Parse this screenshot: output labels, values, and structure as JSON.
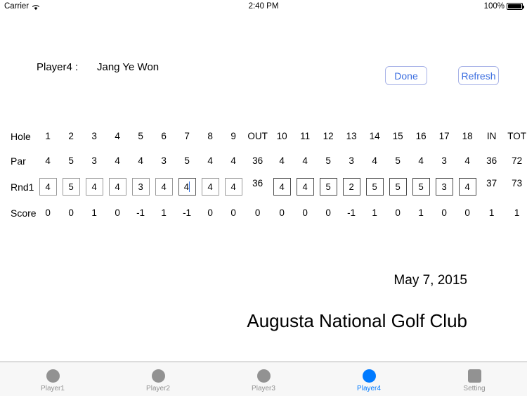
{
  "statusbar": {
    "carrier": "Carrier",
    "wifi_icon": "wifi-icon",
    "time": "2:40 PM",
    "battery_percent": "100%",
    "battery_icon": "battery-full-icon"
  },
  "header": {
    "player_label": "Player4 :",
    "player_name": "Jang Ye Won",
    "done_label": "Done",
    "refresh_label": "Refresh",
    "accent_color": "#3d6fe0"
  },
  "scorecard": {
    "row_labels": {
      "hole": "Hole",
      "par": "Par",
      "round": "Rnd1",
      "score": "Score"
    },
    "columns": [
      "1",
      "2",
      "3",
      "4",
      "5",
      "6",
      "7",
      "8",
      "9",
      "OUT",
      "10",
      "11",
      "12",
      "13",
      "14",
      "15",
      "16",
      "17",
      "18",
      "IN",
      "TOT"
    ],
    "par": [
      "4",
      "5",
      "3",
      "4",
      "4",
      "3",
      "5",
      "4",
      "4",
      "36",
      "4",
      "4",
      "5",
      "3",
      "4",
      "5",
      "4",
      "3",
      "4",
      "36",
      "72"
    ],
    "round1": [
      "4",
      "5",
      "4",
      "4",
      "3",
      "4",
      "4",
      "4",
      "4",
      "36",
      "4",
      "4",
      "5",
      "2",
      "5",
      "5",
      "5",
      "3",
      "4",
      "37",
      "73"
    ],
    "score": [
      "0",
      "0",
      "1",
      "0",
      "-1",
      "1",
      "-1",
      "0",
      "0",
      "0",
      "0",
      "0",
      "0",
      "-1",
      "1",
      "0",
      "1",
      "0",
      "0",
      "1",
      "1"
    ],
    "focused_index": 6,
    "caret_color": "#2f6fe0"
  },
  "footer": {
    "date": "May 7, 2015",
    "course": "Augusta National Golf Club"
  },
  "tabbar": {
    "items": [
      {
        "label": "Player1",
        "icon": "circle-icon",
        "active": false
      },
      {
        "label": "Player2",
        "icon": "circle-icon",
        "active": false
      },
      {
        "label": "Player3",
        "icon": "circle-icon",
        "active": false
      },
      {
        "label": "Player4",
        "icon": "circle-icon",
        "active": true
      },
      {
        "label": "Setting",
        "icon": "square-icon",
        "active": false
      }
    ],
    "active_color": "#007aff",
    "inactive_color": "#929292"
  }
}
